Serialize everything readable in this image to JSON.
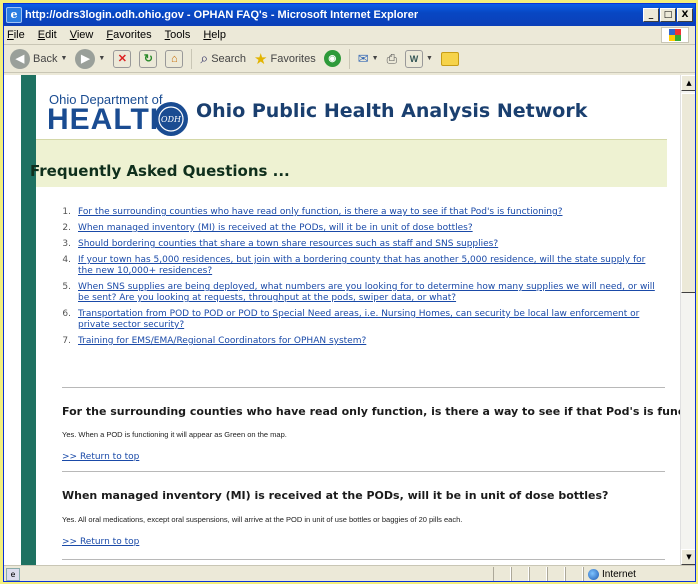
{
  "window": {
    "title": "http://odrs3login.odh.ohio.gov - OPHAN FAQ's - Microsoft Internet Explorer",
    "btn_min": "_",
    "btn_max": "□",
    "btn_close": "X"
  },
  "menu": {
    "items": [
      {
        "u": "F",
        "rest": "ile"
      },
      {
        "u": "E",
        "rest": "dit"
      },
      {
        "u": "V",
        "rest": "iew"
      },
      {
        "u": "F",
        "rest": "avorites"
      },
      {
        "u": "T",
        "rest": "ools"
      },
      {
        "u": "H",
        "rest": "elp"
      }
    ]
  },
  "toolbar": {
    "back_label": "Back",
    "search_label": "Search",
    "favorites_label": "Favorites"
  },
  "header": {
    "logo_line1": "Ohio Department of",
    "logo_line2": "HEALTH",
    "logo_seal": "ODH",
    "site_title": "Ohio Public Health Analysis Network"
  },
  "page": {
    "faq_title": "Frequently Asked Questions ...",
    "questions": [
      {
        "num": "1.",
        "text": "For the surrounding counties who have read only function, is there a way to see if that Pod's is functioning?"
      },
      {
        "num": "2.",
        "text": "When managed inventory (MI) is received at the PODs, will it be in unit of dose bottles?"
      },
      {
        "num": "3.",
        "text": "Should bordering counties that share a town share resources such as staff and SNS supplies?"
      },
      {
        "num": "4.",
        "text": "If your town has 5,000 residences, but join with a bordering county that has another 5,000 residence, will the state supply for the new 10,000+ residences?"
      },
      {
        "num": "5.",
        "text": "When SNS supplies are being deployed, what numbers are you looking for to determine how many supplies we will need, or will be sent? Are you looking at requests, throughput at the pods, swiper data, or what?"
      },
      {
        "num": "6.",
        "text": "Transportation from POD to POD or POD to Special Need areas, i.e. Nursing Homes, can security be local law enforcement or private sector security?"
      },
      {
        "num": "7.",
        "text": "Training for EMS/EMA/Regional Coordinators for OPHAN system?"
      }
    ],
    "answers": [
      {
        "question": "For the surrounding counties who have read only function, is there a way to see if that Pod's is functioning?",
        "answer": "Yes. When a POD is functioning it will appear as Green on the map.",
        "back": ">> Return to top"
      },
      {
        "question": "When managed inventory (MI) is received at the PODs, will it be in unit of dose bottles?",
        "answer": "Yes. All oral medications, except oral suspensions, will arrive at the POD in unit of use bottles or baggies of 20 pills each.",
        "back": ">> Return to top"
      }
    ]
  },
  "status": {
    "zone": "Internet"
  },
  "colors": {
    "sidebar": "#1e7161",
    "banner": "#eef2d2",
    "link": "#1a4aa8",
    "desktop": "#f3ef7c"
  }
}
